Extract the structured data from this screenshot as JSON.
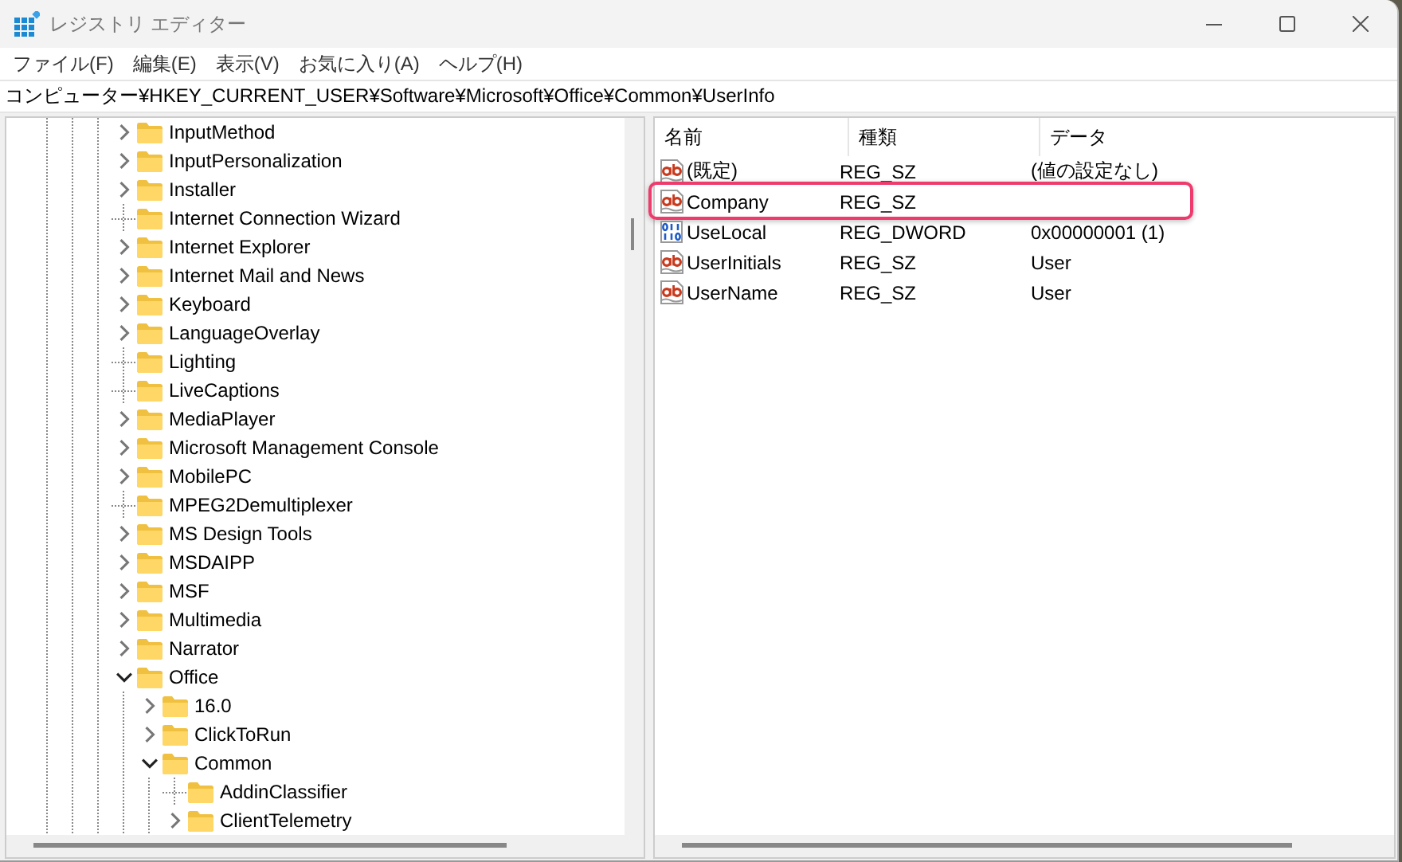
{
  "window": {
    "title": "レジストリ エディター"
  },
  "menu": [
    "ファイル(F)",
    "編集(E)",
    "表示(V)",
    "お気に入り(A)",
    "ヘルプ(H)"
  ],
  "address": {
    "value": "コンピューター¥HKEY_CURRENT_USER¥Software¥Microsoft¥Office¥Common¥UserInfo"
  },
  "tree": {
    "items": [
      {
        "kind": "branch",
        "label": "InputMethod",
        "expanded": false
      },
      {
        "kind": "branch",
        "label": "InputPersonalization",
        "expanded": false
      },
      {
        "kind": "branch",
        "label": "Installer",
        "expanded": false
      },
      {
        "kind": "leaf",
        "label": "Internet Connection Wizard"
      },
      {
        "kind": "branch",
        "label": "Internet Explorer",
        "expanded": false
      },
      {
        "kind": "branch",
        "label": "Internet Mail and News",
        "expanded": false
      },
      {
        "kind": "branch",
        "label": "Keyboard",
        "expanded": false
      },
      {
        "kind": "branch",
        "label": "LanguageOverlay",
        "expanded": false
      },
      {
        "kind": "leaf",
        "label": "Lighting"
      },
      {
        "kind": "leaf",
        "label": "LiveCaptions"
      },
      {
        "kind": "branch",
        "label": "MediaPlayer",
        "expanded": false
      },
      {
        "kind": "branch",
        "label": "Microsoft Management Console",
        "expanded": false
      },
      {
        "kind": "branch",
        "label": "MobilePC",
        "expanded": false
      },
      {
        "kind": "leaf",
        "label": "MPEG2Demultiplexer"
      },
      {
        "kind": "branch",
        "label": "MS Design Tools",
        "expanded": false
      },
      {
        "kind": "branch",
        "label": "MSDAIPP",
        "expanded": false
      },
      {
        "kind": "branch",
        "label": "MSF",
        "expanded": false
      },
      {
        "kind": "branch",
        "label": "Multimedia",
        "expanded": false
      },
      {
        "kind": "branch",
        "label": "Narrator",
        "expanded": false
      },
      {
        "kind": "branch",
        "label": "Office",
        "expanded": true,
        "children": [
          {
            "kind": "branch",
            "label": "16.0",
            "expanded": false
          },
          {
            "kind": "branch",
            "label": "ClickToRun",
            "expanded": false
          },
          {
            "kind": "branch",
            "label": "Common",
            "expanded": true,
            "children": [
              {
                "kind": "leaf",
                "label": "AddinClassifier"
              },
              {
                "kind": "branch",
                "label": "ClientTelemetry",
                "expanded": false
              }
            ]
          }
        ]
      }
    ]
  },
  "values": {
    "columns": [
      "名前",
      "種類",
      "データ"
    ],
    "rows": [
      {
        "kind": "string",
        "name": "(既定)",
        "type": "REG_SZ",
        "data": "(値の設定なし)",
        "highlighted": false
      },
      {
        "kind": "string",
        "name": "Company",
        "type": "REG_SZ",
        "highlighted": true
      },
      {
        "kind": "dword",
        "name": "UseLocal",
        "type": "REG_DWORD",
        "data": "0x00000001 (1)",
        "highlighted": false
      },
      {
        "kind": "string",
        "name": "UserInitials",
        "type": "REG_SZ",
        "data": "User",
        "highlighted": false
      },
      {
        "kind": "string",
        "name": "UserName",
        "type": "REG_SZ",
        "data": "User",
        "highlighted": false
      }
    ]
  }
}
